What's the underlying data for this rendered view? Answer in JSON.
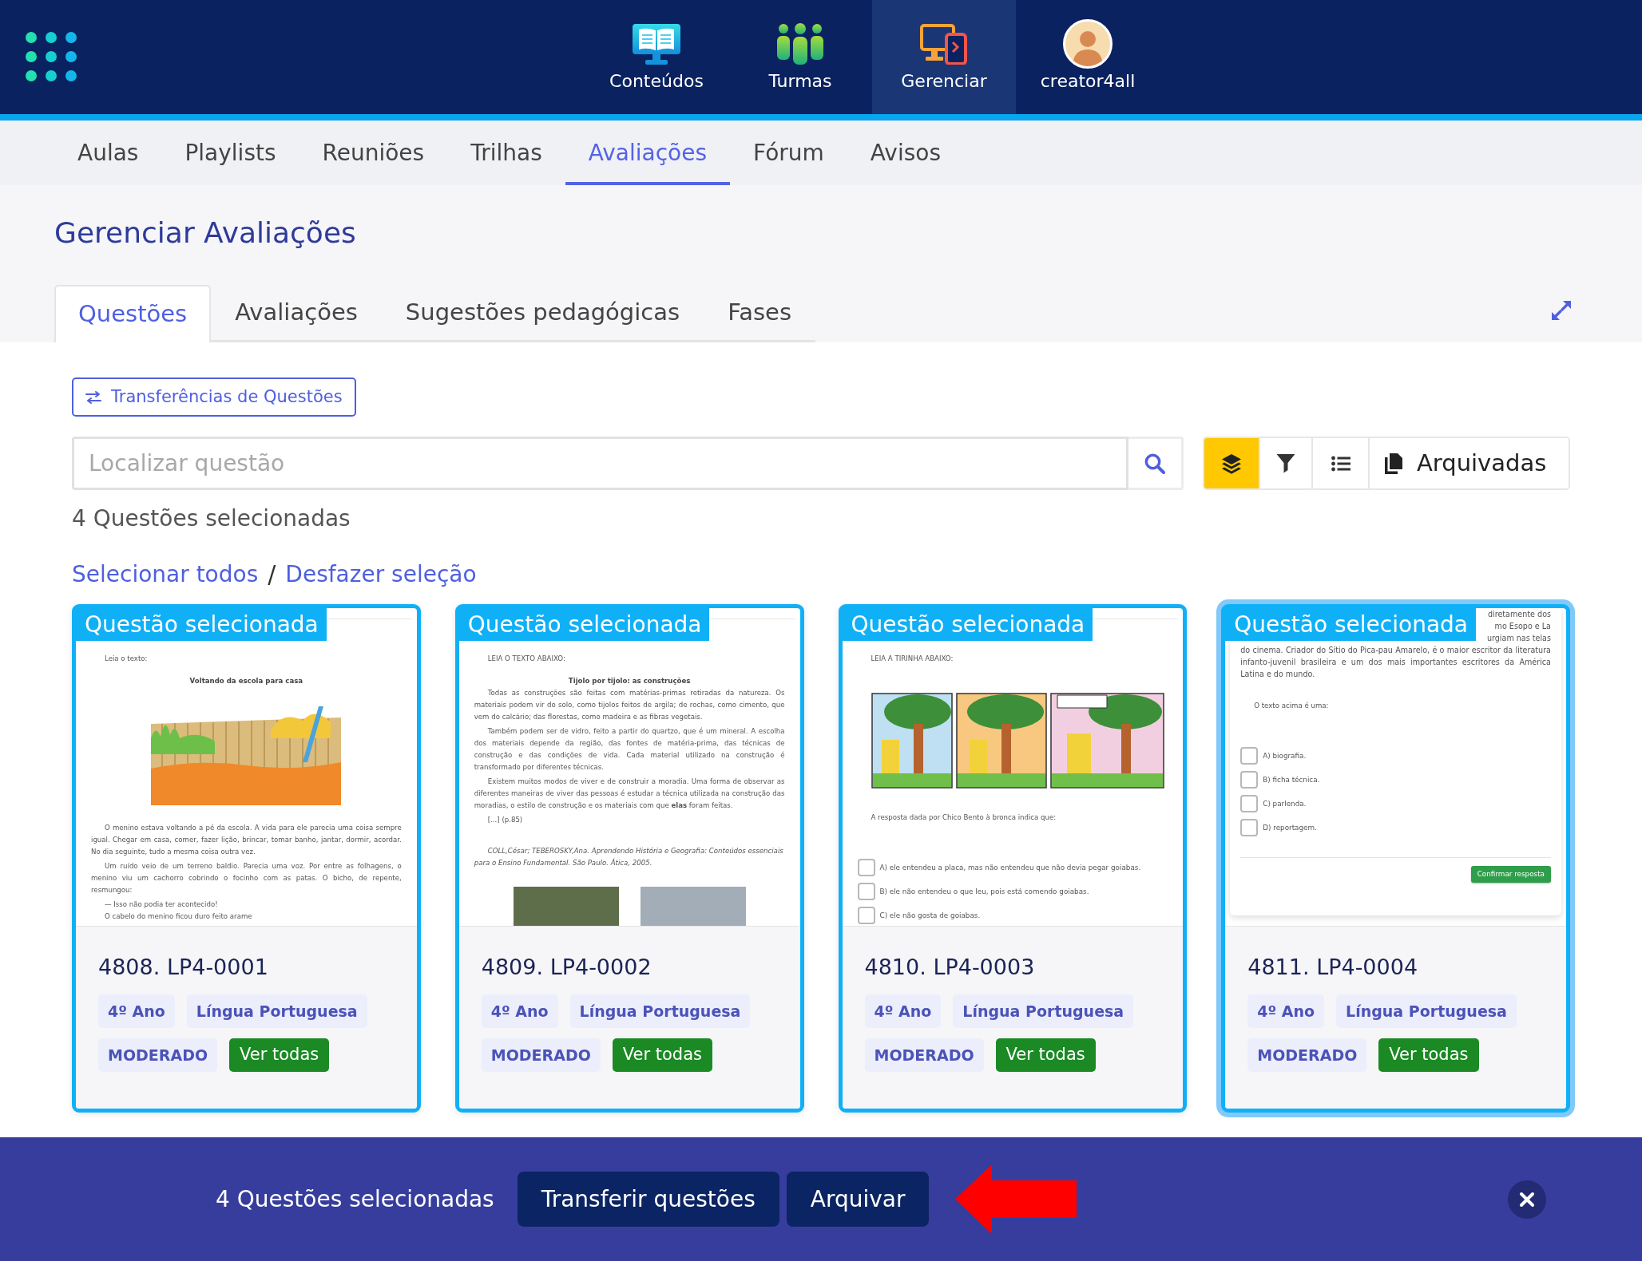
{
  "header": {
    "nav": [
      {
        "label": "Conteúdos",
        "selected": false
      },
      {
        "label": "Turmas",
        "selected": false
      },
      {
        "label": "Gerenciar",
        "selected": true
      }
    ],
    "user": "creator4all"
  },
  "sections": [
    {
      "label": "Aulas",
      "selected": false
    },
    {
      "label": "Playlists",
      "selected": false
    },
    {
      "label": "Reuniões",
      "selected": false
    },
    {
      "label": "Trilhas",
      "selected": false
    },
    {
      "label": "Avaliações",
      "selected": true
    },
    {
      "label": "Fórum",
      "selected": false
    },
    {
      "label": "Avisos",
      "selected": false
    }
  ],
  "page_title": "Gerenciar Avaliações",
  "tabs": [
    {
      "label": "Questões",
      "selected": true
    },
    {
      "label": "Avaliações",
      "selected": false
    },
    {
      "label": "Sugestões pedagógicas",
      "selected": false
    },
    {
      "label": "Fases",
      "selected": false
    }
  ],
  "transfer_link": "Transferências de Questões",
  "search": {
    "placeholder": "Localizar questão"
  },
  "view_buttons": [
    {
      "selected": true
    },
    {
      "selected": false
    },
    {
      "selected": false
    },
    {
      "label": "Arquivadas",
      "selected": false
    }
  ],
  "selection": {
    "count": "4 Questões selecionadas",
    "select_all": "Selecionar todos",
    "separator": "/",
    "clear": "Desfazer seleção"
  },
  "cards": [
    {
      "selected": true,
      "highlighted": false,
      "scrolled": false,
      "selected_label": "Questão selecionada",
      "preview": [
        {
          "kind": "label",
          "text": "Leia o texto:"
        },
        {
          "kind": "heading",
          "text": "Voltando da escola para casa"
        },
        {
          "kind": "image"
        },
        {
          "kind": "paragraph",
          "text": "O menino estava voltando a pé da escola. A vida para ele parecia uma coisa sempre igual. Chegar em casa, comer, fazer lição, brincar, tomar banho, jantar, dormir, acordar. No dia seguinte, tudo a mesma coisa outra vez."
        },
        {
          "kind": "paragraph",
          "text": "Um ruído veio de um terreno baldio. Parecia uma voz. Por entre as folhagens, o menino viu um cachorro cobrindo o focinho com as patas. O bicho, de repente, resmungou:"
        },
        {
          "kind": "line",
          "text": "— Isso não podia ter acontecido!"
        },
        {
          "kind": "line",
          "text": "O cabelo do menino ficou duro feito arame"
        }
      ],
      "code": "4808. LP4-0001",
      "tags": [
        "4º Ano",
        "Língua Portuguesa"
      ],
      "difficulty": "MODERADO",
      "action": "Ver todas"
    },
    {
      "selected": true,
      "highlighted": false,
      "scrolled": false,
      "selected_label": "Questão selecionada",
      "preview": [
        {
          "kind": "label",
          "text": "LEIA O TEXTO ABAIXO:"
        },
        {
          "kind": "heading",
          "text": "Tijolo por tijolo: as construções"
        },
        {
          "kind": "paragraph",
          "text": "Todas as construções são feitas com matérias-primas retiradas da natureza. Os materiais podem vir do solo, como tijolos feitos de argila; de rochas, como cimento, que vem do calcário; das florestas, como madeira e as fibras vegetais."
        },
        {
          "kind": "paragraph",
          "text": "Também podem ser de vidro, feito a partir do quartzo, que é um mineral. A escolha dos materiais depende da região, das fontes de matéria-prima, das técnicas de construção e das condições de vida. Cada material utilizado na construção é transformado por diferentes técnicas."
        },
        {
          "kind": "paragraph",
          "text": "Existem muitos modos de viver e de construir a moradia. Uma forma de observar as diferentes maneiras de viver das pessoas é estudar a técnica utilizada na construção das moradias, o estilo de construção e os materiais com que **elas** foram feitas."
        },
        {
          "kind": "line",
          "text": "[...] (p.85)"
        },
        {
          "kind": "citation",
          "text": "COLL,César; TEBEROSKY,Ana. Aprendendo História e Geografia: Conteúdos essenciais para o Ensino Fundamental. São Paulo. Ática, 2005."
        },
        {
          "kind": "photos"
        }
      ],
      "code": "4809. LP4-0002",
      "tags": [
        "4º Ano",
        "Língua Portuguesa"
      ],
      "difficulty": "MODERADO",
      "action": "Ver todas"
    },
    {
      "selected": true,
      "highlighted": false,
      "scrolled": false,
      "selected_label": "Questão selecionada",
      "preview": [
        {
          "kind": "label",
          "text": "LEIA A TIRINHA ABAIXO:"
        },
        {
          "kind": "comic"
        },
        {
          "kind": "question",
          "text": "A resposta dada por Chico Bento à bronca indica que:"
        },
        {
          "kind": "option",
          "text": "A) ele entendeu a placa, mas não entendeu que não devia pegar goiabas.",
          "checked": false
        },
        {
          "kind": "option",
          "text": "B) ele não entendeu o que leu, pois está comendo goiabas.",
          "checked": false
        },
        {
          "kind": "option",
          "text": "C) ele não gosta de goiabas.",
          "checked": false
        }
      ],
      "code": "4810. LP4-0003",
      "tags": [
        "4º Ano",
        "Língua Portuguesa"
      ],
      "difficulty": "MODERADO",
      "action": "Ver todas"
    },
    {
      "selected": true,
      "highlighted": true,
      "scrolled": true,
      "selected_label": "Questão selecionada",
      "preview": [
        {
          "kind": "fragment",
          "text": "diretamente dos"
        },
        {
          "kind": "fragment",
          "text": "mo Esopo e La"
        },
        {
          "kind": "fragment",
          "text": "urgiam nas telas"
        },
        {
          "kind": "continued",
          "text": "do cinema. Criador do Sítio do Pica-pau Amarelo, é o maior escritor da literatura infanto-juvenil brasileira e um dos mais importantes escritores da América Latina e do mundo."
        },
        {
          "kind": "question",
          "text": "O texto acima é uma:"
        },
        {
          "kind": "option",
          "text": "A) biografia.",
          "checked": false
        },
        {
          "kind": "option",
          "text": "B) ficha técnica.",
          "checked": false
        },
        {
          "kind": "option",
          "text": "C) parlenda.",
          "checked": false
        },
        {
          "kind": "option",
          "text": "D) reportagem.",
          "checked": false
        },
        {
          "kind": "submit",
          "text": "Confirmar resposta"
        }
      ],
      "code": "4811. LP4-0004",
      "tags": [
        "4º Ano",
        "Língua Portuguesa"
      ],
      "difficulty": "MODERADO",
      "action": "Ver todas"
    }
  ],
  "action_bar": {
    "count": "4 Questões selecionadas",
    "buttons": [
      "Transferir questões",
      "Arquivar"
    ]
  }
}
